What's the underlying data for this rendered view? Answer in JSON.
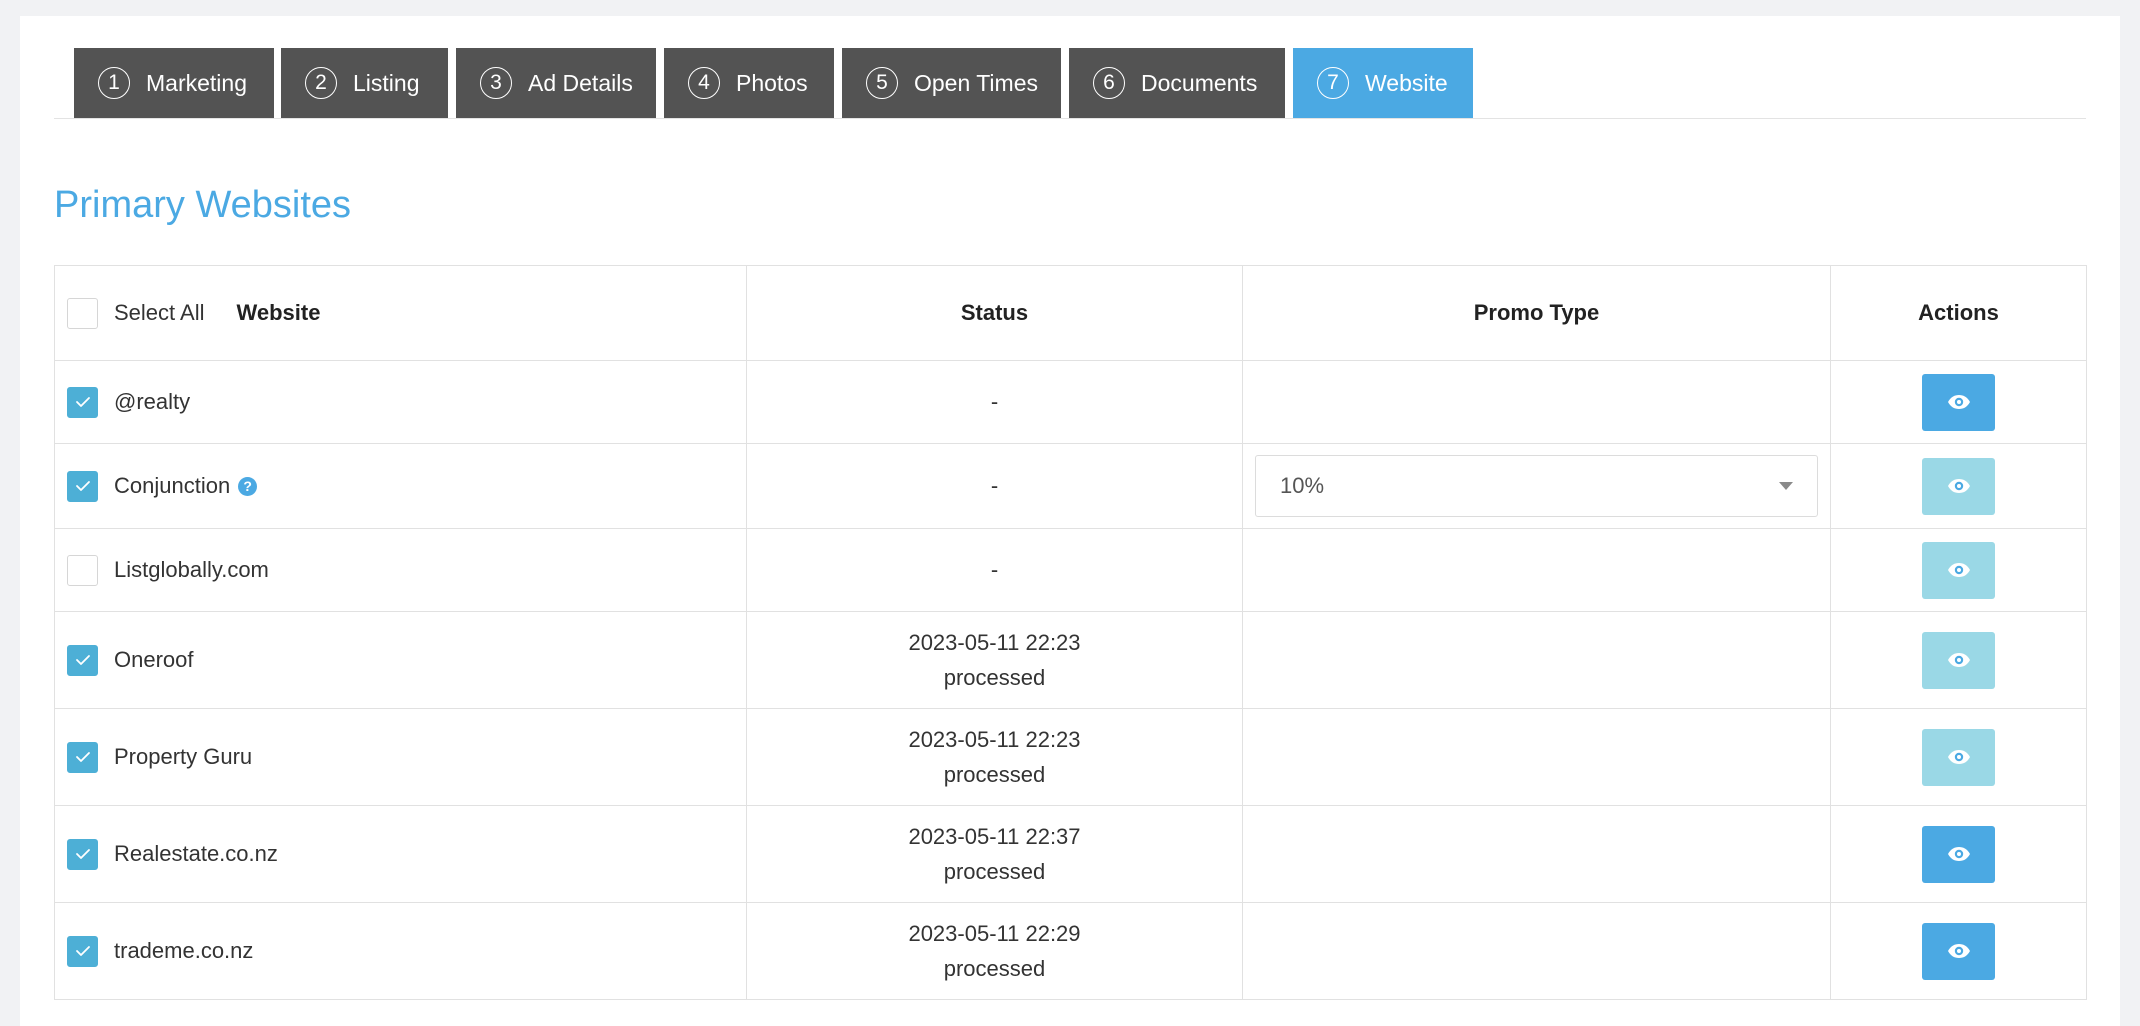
{
  "tabs": [
    {
      "num": "1",
      "label": "Marketing"
    },
    {
      "num": "2",
      "label": "Listing"
    },
    {
      "num": "3",
      "label": "Ad Details"
    },
    {
      "num": "4",
      "label": "Photos"
    },
    {
      "num": "5",
      "label": "Open Times"
    },
    {
      "num": "6",
      "label": "Documents"
    },
    {
      "num": "7",
      "label": "Website",
      "active": true
    }
  ],
  "heading": "Primary Websites",
  "table": {
    "select_all_label": "Select All",
    "headers": {
      "website": "Website",
      "status": "Status",
      "promo": "Promo Type",
      "actions": "Actions"
    },
    "rows": [
      {
        "website": "@realty",
        "checked": true,
        "status_date": "-",
        "status_text": "",
        "promo": "",
        "view_enabled": true
      },
      {
        "website": "Conjunction",
        "checked": true,
        "help": true,
        "status_date": "-",
        "status_text": "",
        "promo": "10%",
        "view_enabled": false
      },
      {
        "website": "Listglobally.com",
        "checked": false,
        "status_date": "-",
        "status_text": "",
        "promo": "",
        "view_enabled": false
      },
      {
        "website": "Oneroof",
        "checked": true,
        "status_date": "2023-05-11 22:23",
        "status_text": "processed",
        "promo": "",
        "view_enabled": false
      },
      {
        "website": "Property Guru",
        "checked": true,
        "status_date": "2023-05-11 22:23",
        "status_text": "processed",
        "promo": "",
        "view_enabled": false
      },
      {
        "website": "Realestate.co.nz",
        "checked": true,
        "status_date": "2023-05-11 22:37",
        "status_text": "processed",
        "promo": "",
        "view_enabled": true
      },
      {
        "website": "trademe.co.nz",
        "checked": true,
        "status_date": "2023-05-11 22:29",
        "status_text": "processed",
        "promo": "",
        "view_enabled": true
      }
    ]
  },
  "colors": {
    "accent": "#4ba9e3",
    "tab_bg": "#535353",
    "checkbox_on": "#4dafd6",
    "button_disabled": "#9ad8e6"
  },
  "icons": {
    "view": "eye-icon",
    "check": "check-icon",
    "help": "question-circle-icon",
    "dropdown": "chevron-down-icon"
  }
}
